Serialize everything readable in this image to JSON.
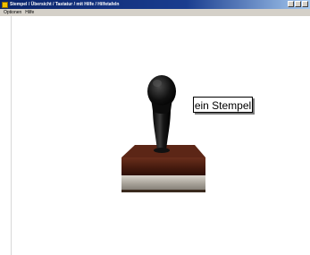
{
  "window": {
    "title": "Stempel / Übersicht / Tastatur / mit Hilfe / Hilfetafeln"
  },
  "menu": {
    "items": [
      {
        "label": "Optionen"
      },
      {
        "label": "Hilfe"
      }
    ]
  },
  "tooltip": {
    "text": "ein Stempel"
  },
  "icons": {
    "app": "app-icon",
    "stamp": "rubber-stamp-icon"
  }
}
